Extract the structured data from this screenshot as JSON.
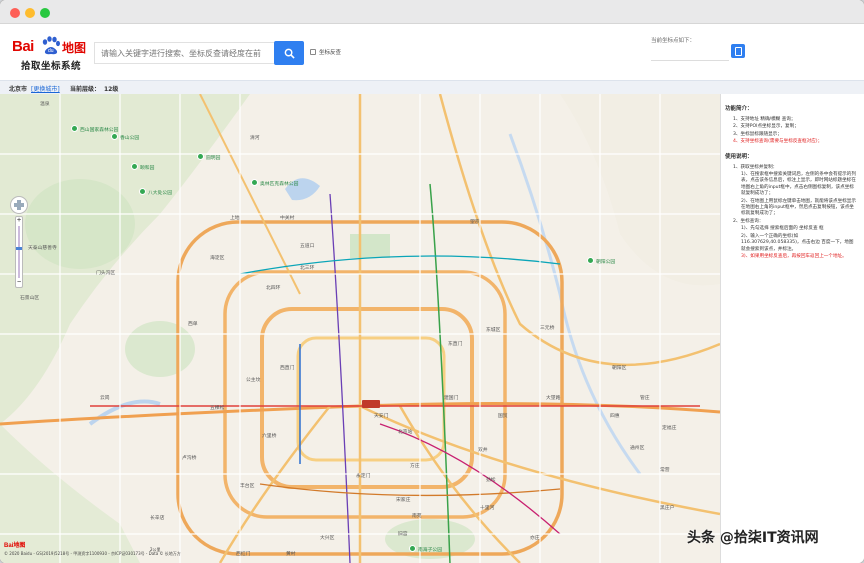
{
  "header": {
    "logo_bai": "Bai",
    "logo_du": "du",
    "logo_map": "地图",
    "logo_sub": "拾取坐标系统",
    "search_placeholder": "请输入关键字进行搜索、坐标反查请经度在前",
    "reverse_label": "坐标反查",
    "coord_label": "当前坐标点如下：",
    "coord_value": ""
  },
  "infobar": {
    "city": "北京市",
    "switch_city": "[更换城市]",
    "zoom_label": "当前层级：",
    "zoom_value": "12级"
  },
  "sidebar": {
    "features_title": "功能简介：",
    "features": [
      "1、支持地址 精确/模糊 查询；",
      "2、支持POI点坐标显示，复制；",
      "3、坐标鼠标跟随显示；",
      "4、支持坐标查询(需要与坐标反查框对应)；"
    ],
    "usage_title": "使用说明：",
    "usage_1_title": "1、获取坐标并复制：",
    "usage_1_items": [
      "1)、在搜索框中搜索关键词后，左侧的条中会有提示的列表，点击该条信息后，标注上显示，即时网站标题坐标在地图右上角的input框中，点击右侧图标复制，该点坐标就复制成功了；",
      "2)、在地图上用鼠标左键单击地图，就能将该点坐标显示在地图右上角的input框中，然后点击复制按钮，该点坐标就复制成功了；"
    ],
    "usage_2_title": "2、坐标查询：",
    "usage_2_items": [
      "1)、先勾选择 搜索框后面的 坐标反查 框",
      "2)、输入一个正确的坐标(如116.307629,40.058335)，点击右边 百度一下，地图就会搜索到该点，并标注。",
      "3)、如果用坐标反查后，再按回车返回上一个地址。"
    ],
    "usage_1_2_highlight": "坐标反查框"
  },
  "map": {
    "labels": [
      {
        "text": "温泉",
        "park": false
      },
      {
        "text": "西山国家森林公园",
        "park": true
      },
      {
        "text": "香山公园",
        "park": true
      },
      {
        "text": "八大处公园",
        "park": true
      },
      {
        "text": "天泰山慈善寺",
        "park": false
      },
      {
        "text": "门头沟区",
        "park": false
      },
      {
        "text": "石景山区",
        "park": false
      },
      {
        "text": "西单",
        "park": false
      },
      {
        "text": "北京站",
        "park": false
      },
      {
        "text": "天安门",
        "park": false
      },
      {
        "text": "东城区",
        "park": false
      },
      {
        "text": "朝阳区",
        "park": false
      },
      {
        "text": "海淀区",
        "park": false
      },
      {
        "text": "北四环",
        "park": false
      },
      {
        "text": "北三环",
        "park": false
      },
      {
        "text": "望京",
        "park": false
      },
      {
        "text": "丰台区",
        "park": false
      },
      {
        "text": "大兴区",
        "park": false
      },
      {
        "text": "南苑",
        "park": false
      },
      {
        "text": "亦庄",
        "park": false
      },
      {
        "text": "通州区",
        "park": false
      },
      {
        "text": "奥林匹克森林公园",
        "park": true
      },
      {
        "text": "颐和园",
        "park": true
      },
      {
        "text": "圆明园",
        "park": true
      },
      {
        "text": "朝阳公园",
        "park": true
      },
      {
        "text": "南海子公园",
        "park": true
      },
      {
        "text": "永定门",
        "park": false
      },
      {
        "text": "五棵松",
        "park": false
      },
      {
        "text": "公主坟",
        "park": false
      },
      {
        "text": "建国门",
        "park": false
      },
      {
        "text": "大望路",
        "park": false
      },
      {
        "text": "四惠",
        "park": false
      },
      {
        "text": "双井",
        "park": false
      },
      {
        "text": "劲松",
        "park": false
      },
      {
        "text": "十里河",
        "park": false
      },
      {
        "text": "方庄",
        "park": false
      },
      {
        "text": "六里桥",
        "park": false
      },
      {
        "text": "卢沟桥",
        "park": false
      },
      {
        "text": "长辛店",
        "park": false
      },
      {
        "text": "云岗",
        "park": false
      },
      {
        "text": "宋家庄",
        "park": false
      },
      {
        "text": "旧宫",
        "park": false
      },
      {
        "text": "黄村",
        "park": false
      },
      {
        "text": "西红门",
        "park": false
      },
      {
        "text": "清河",
        "park": false
      },
      {
        "text": "上地",
        "park": false
      },
      {
        "text": "中关村",
        "park": false
      },
      {
        "text": "五道口",
        "park": false
      },
      {
        "text": "西直门",
        "park": false
      },
      {
        "text": "东直门",
        "park": false
      },
      {
        "text": "三元桥",
        "park": false
      },
      {
        "text": "国贸",
        "park": false
      },
      {
        "text": "管庄",
        "park": false
      },
      {
        "text": "定福庄",
        "park": false
      },
      {
        "text": "常营",
        "park": false
      },
      {
        "text": "黑庄户",
        "park": false
      }
    ],
    "copyright": "© 2020 Baidu - GS(2019)5218号 - 甲测资字1100930 - 京ICP证030173号 - Data © 长地万方",
    "scale_label": "2公里",
    "baidu_logo": "Bai地图"
  },
  "watermark": "头条 @拾柒IT资讯网",
  "colors": {
    "brand_red": "#e10601",
    "accent_blue": "#2f7ff0",
    "park_green": "#34a853"
  }
}
